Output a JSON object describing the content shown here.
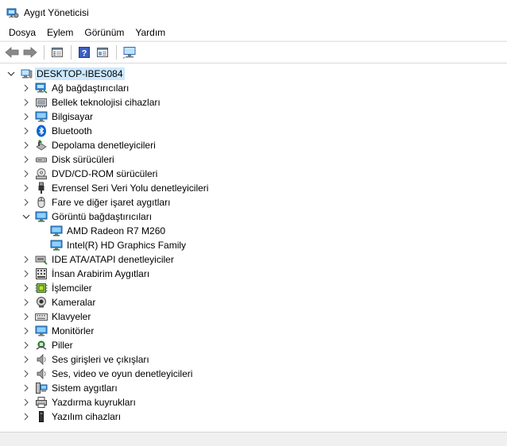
{
  "window": {
    "title": "Aygıt Yöneticisi"
  },
  "menu": {
    "items": [
      "Dosya",
      "Eylem",
      "Görünüm",
      "Yardım"
    ]
  },
  "toolbar": {
    "buttons": [
      "back-arrow-icon",
      "forward-arrow-icon",
      "properties-icon",
      "help-icon",
      "show-hide-icon",
      "monitor-icon"
    ]
  },
  "tree": {
    "root": "DESKTOP-IBES084",
    "categories": [
      "Ağ bağdaştırıcıları",
      "Bellek teknolojisi cihazları",
      "Bilgisayar",
      "Bluetooth",
      "Depolama denetleyicileri",
      "Disk sürücüleri",
      "DVD/CD-ROM sürücüleri",
      "Evrensel Seri Veri Yolu denetleyicileri",
      "Fare ve diğer işaret aygıtları",
      "Görüntü bağdaştırıcıları",
      "IDE ATA/ATAPI denetleyiciler",
      "İnsan Arabirim Aygıtları",
      "İşlemciler",
      "Kameralar",
      "Klavyeler",
      "Monitörler",
      "Piller",
      "Ses girişleri ve çıkışları",
      "Ses, video ve oyun denetleyicileri",
      "Sistem aygıtları",
      "Yazdırma kuyrukları",
      "Yazılım cihazları"
    ],
    "display_children": [
      "AMD Radeon R7 M260",
      "Intel(R) HD Graphics Family"
    ]
  },
  "colors": {
    "selection": "#cce8ff",
    "accent": "#0078d7"
  }
}
